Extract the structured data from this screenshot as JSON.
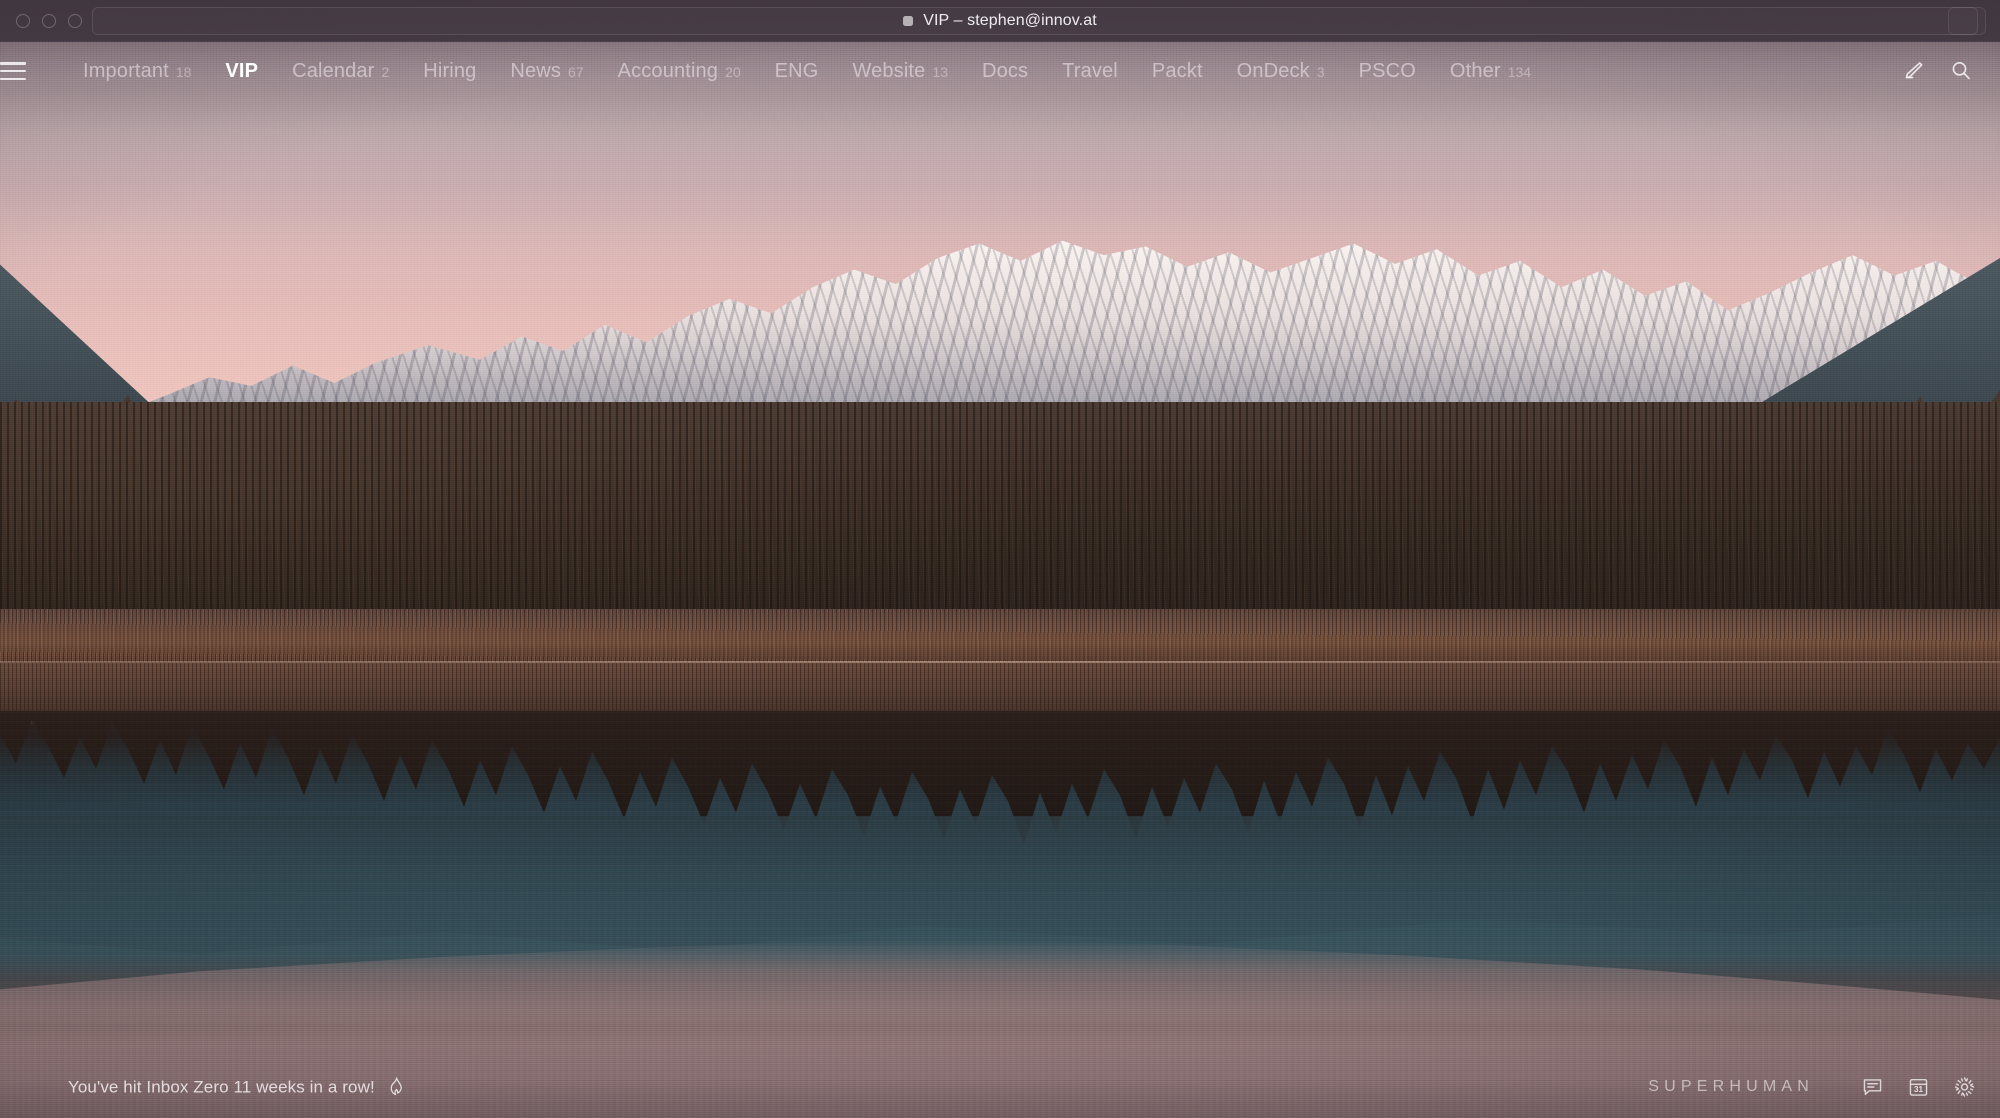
{
  "window": {
    "title": "VIP – stephen@innov.at",
    "title_badge_icon": "split-indicator-icon",
    "traffic_lights": [
      "close-button",
      "minimize-button",
      "zoom-button"
    ]
  },
  "nav": {
    "menu_icon": "hamburger-menu-icon",
    "splits": [
      {
        "label": "Important",
        "count": "18",
        "active": false
      },
      {
        "label": "VIP",
        "count": "",
        "active": true
      },
      {
        "label": "Calendar",
        "count": "2",
        "active": false
      },
      {
        "label": "Hiring",
        "count": "",
        "active": false
      },
      {
        "label": "News",
        "count": "67",
        "active": false
      },
      {
        "label": "Accounting",
        "count": "20",
        "active": false
      },
      {
        "label": "ENG",
        "count": "",
        "active": false
      },
      {
        "label": "Website",
        "count": "13",
        "active": false
      },
      {
        "label": "Docs",
        "count": "",
        "active": false
      },
      {
        "label": "Travel",
        "count": "",
        "active": false
      },
      {
        "label": "Packt",
        "count": "",
        "active": false
      },
      {
        "label": "OnDeck",
        "count": "3",
        "active": false
      },
      {
        "label": "PSCO",
        "count": "",
        "active": false
      },
      {
        "label": "Other",
        "count": "134",
        "active": false
      }
    ],
    "actions": [
      {
        "icon": "compose-pencil-icon",
        "label": "Compose"
      },
      {
        "icon": "search-icon",
        "label": "Search"
      }
    ]
  },
  "status": {
    "inbox_zero_message": "You've hit Inbox Zero 11 weeks in a row!",
    "streak_icon": "flame-icon",
    "brand": "SUPERHUMAN",
    "icons": [
      {
        "icon": "chat-bubble-icon",
        "label": "Feedback"
      },
      {
        "icon": "calendar-icon",
        "label": "Calendar",
        "day": "31"
      },
      {
        "icon": "gear-icon",
        "label": "Settings"
      }
    ]
  },
  "background": {
    "scene": "lake-matheson-sunrise-photo",
    "sky_top_color": "#5c4d5a",
    "sky_horizon_color": "#f0c7bf",
    "snow_color": "#f4efec",
    "ridge_color": "#3c4b53",
    "forest_color": "#3e3029",
    "reed_color": "#78533f",
    "water_color": "#334b55"
  }
}
